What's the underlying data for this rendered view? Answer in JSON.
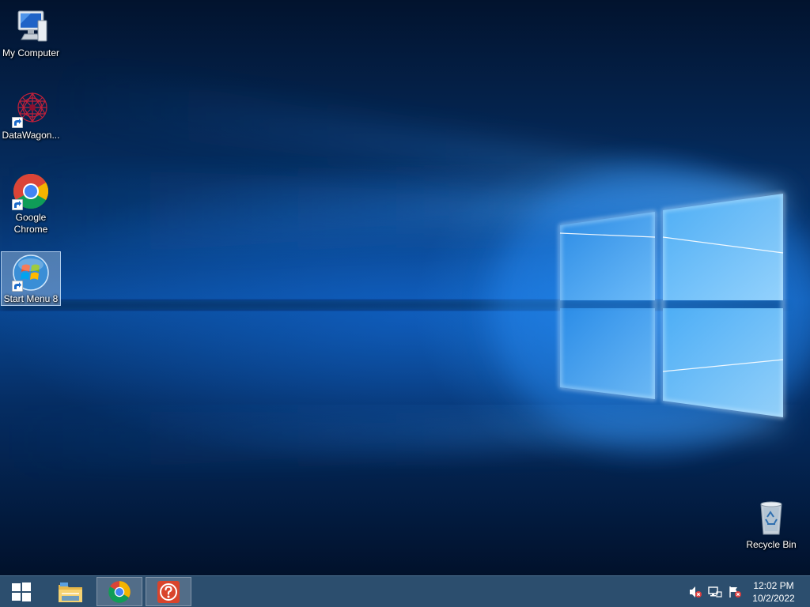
{
  "desktop": {
    "icons": [
      {
        "label": "My Computer",
        "icon": "my-computer-icon"
      },
      {
        "label": "DataWagon...",
        "icon": "datawagon-icon"
      },
      {
        "label": "Google Chrome",
        "icon": "chrome-icon"
      },
      {
        "label": "Start Menu 8",
        "icon": "start-menu-8-icon"
      }
    ],
    "recycle_bin": {
      "label": "Recycle Bin",
      "icon": "recycle-bin-icon"
    }
  },
  "taskbar": {
    "start": {
      "icon": "windows-logo-icon"
    },
    "pinned": [
      {
        "name": "file-explorer",
        "icon": "folder-icon"
      },
      {
        "name": "google-chrome",
        "icon": "chrome-icon",
        "active": true
      },
      {
        "name": "help",
        "icon": "help-icon",
        "active": true
      }
    ],
    "tray": {
      "icons": [
        "speaker-muted-icon",
        "network-error-icon",
        "action-center-flag-icon"
      ],
      "time": "12:02 PM",
      "date": "10/2/2022"
    }
  },
  "colors": {
    "taskbar_bg": "#2c4e6e",
    "wallpaper_blue": "#0a4a98",
    "help_red": "#d9442c"
  }
}
